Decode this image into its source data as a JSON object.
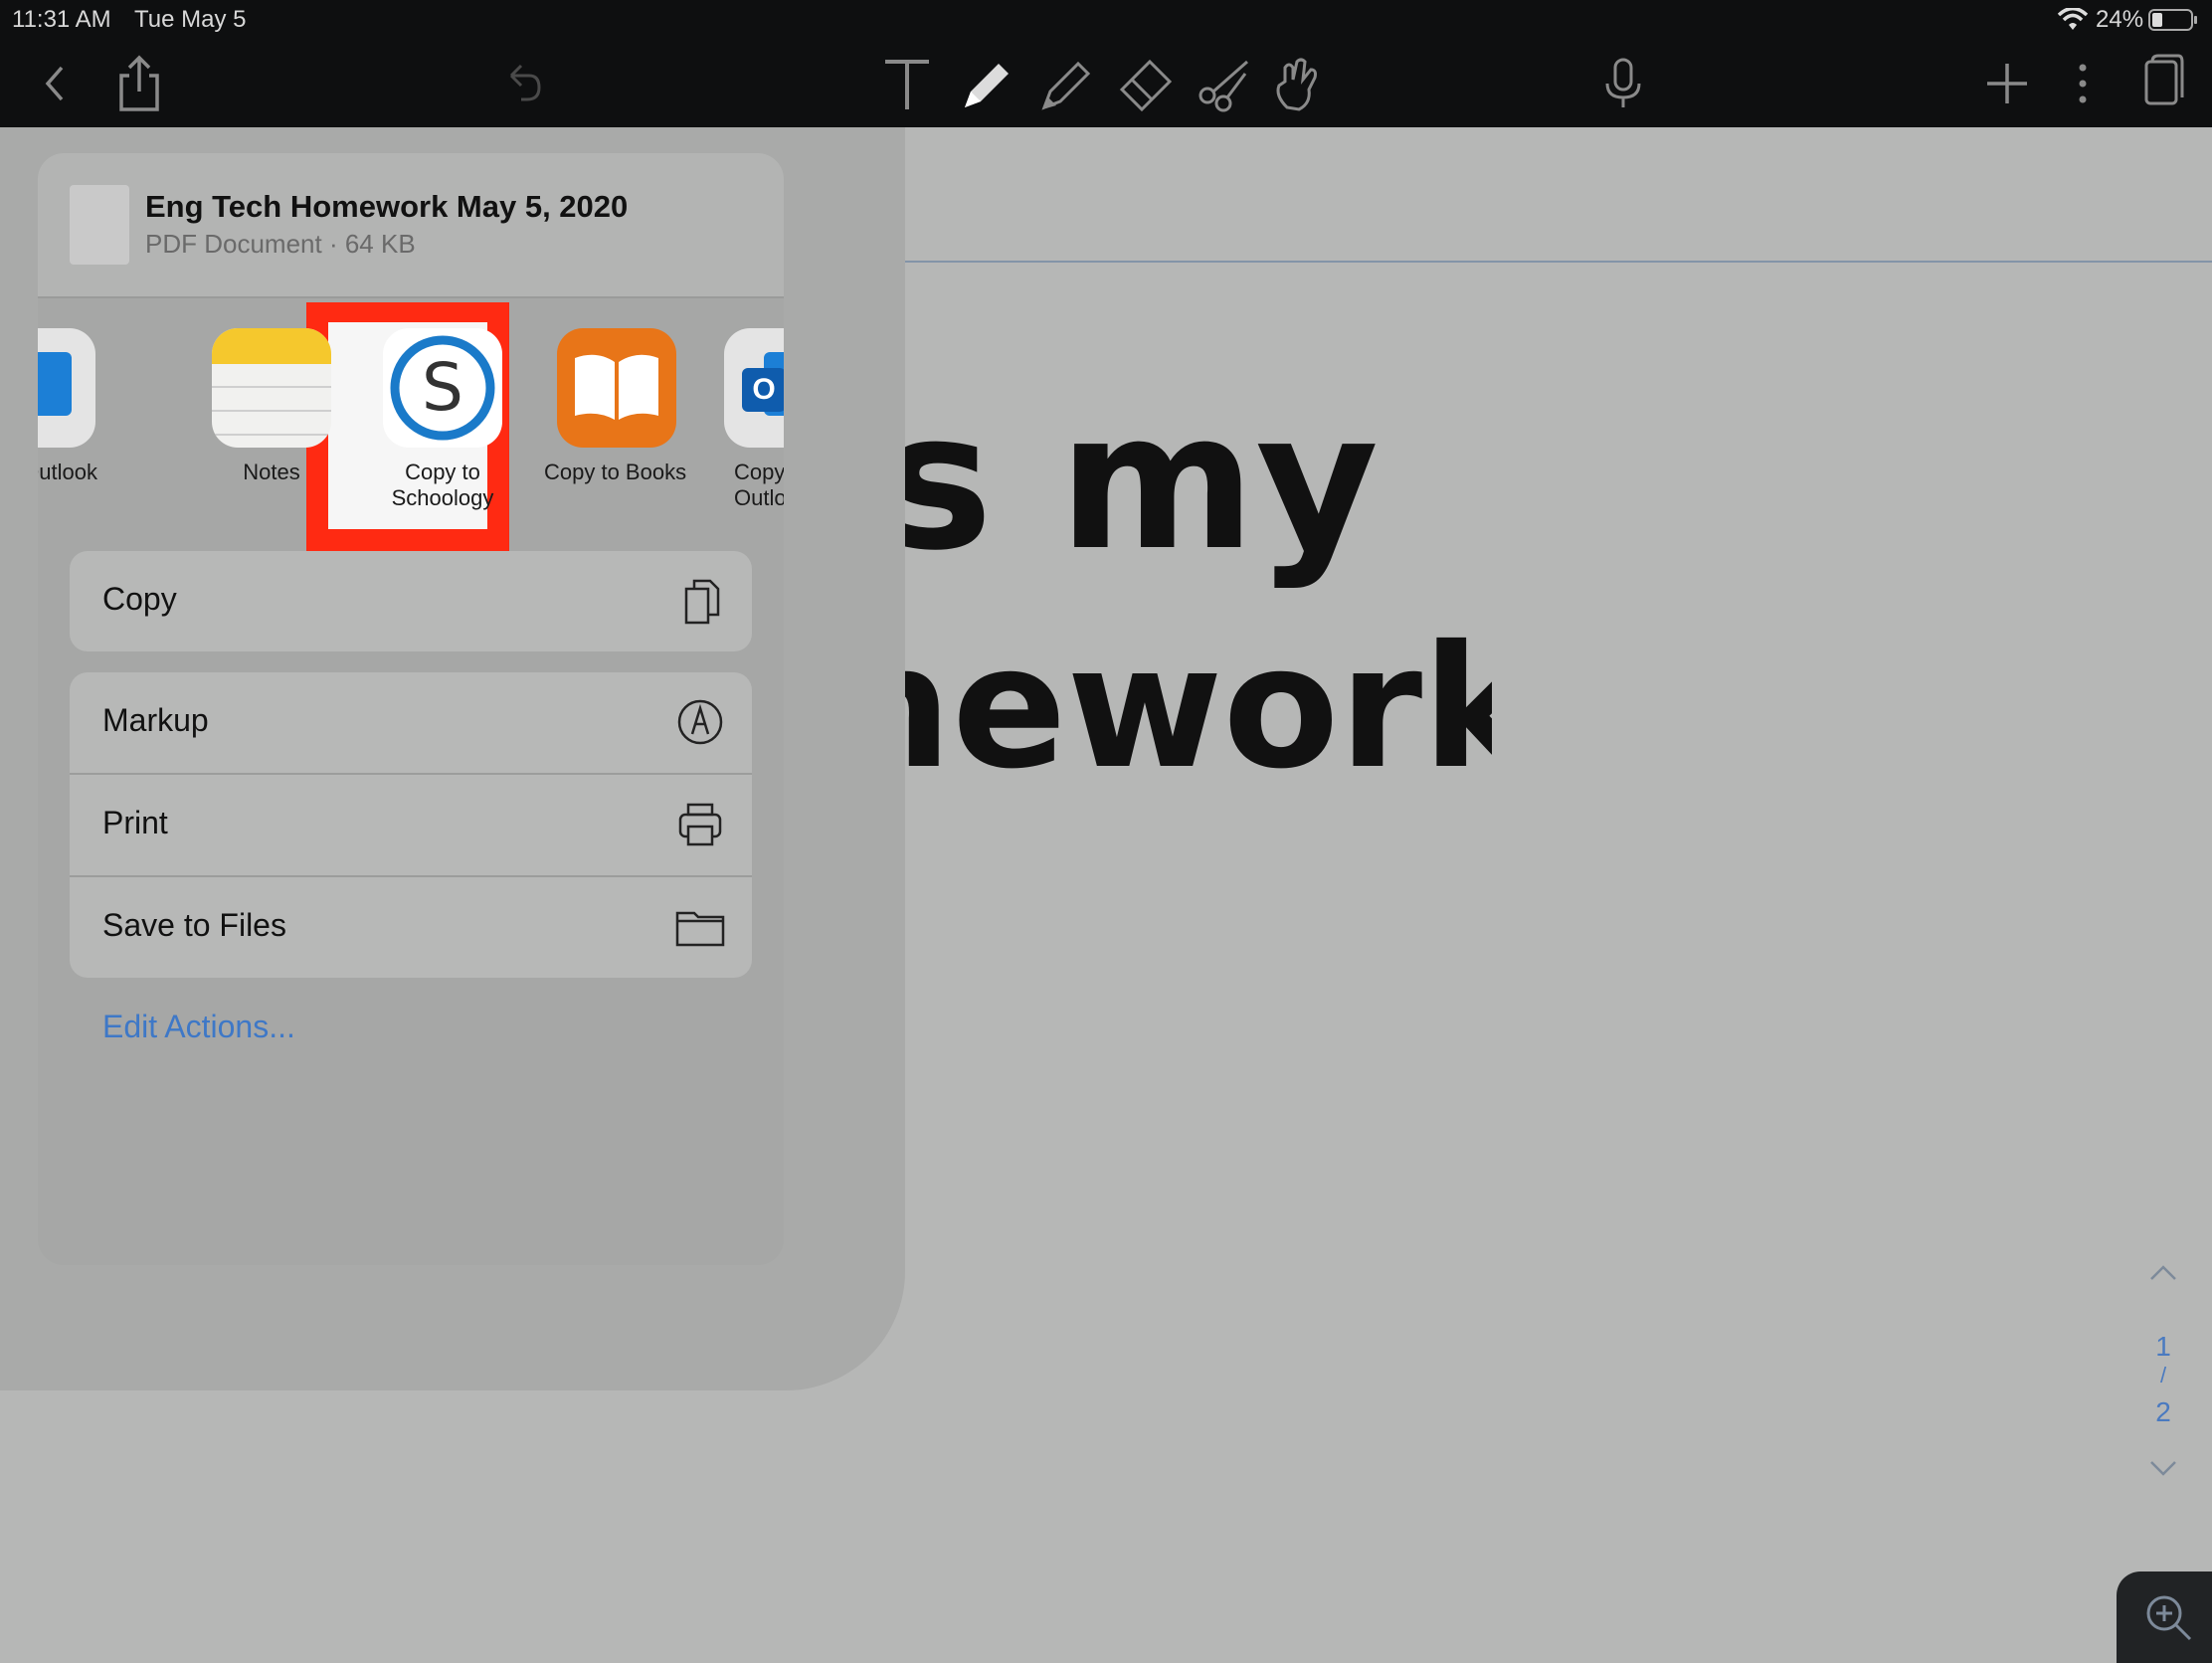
{
  "status_bar": {
    "time": "11:31 AM",
    "date": "Tue May 5",
    "battery_pct": "24%"
  },
  "toolbar": {
    "icons": [
      "back-icon",
      "share-icon",
      "undo-icon",
      "text-icon",
      "pen-icon",
      "highlighter-icon",
      "eraser-icon",
      "scissors-icon",
      "hand-icon",
      "microphone-icon",
      "add-icon",
      "more-icon",
      "pages-icon"
    ]
  },
  "share": {
    "doc_title": "Eng Tech Homework May 5, 2020",
    "doc_subtitle": "PDF Document · 64 KB",
    "apps": [
      {
        "label": "Outlook",
        "icon": "outlook-icon"
      },
      {
        "label": "Notes",
        "icon": "notes-icon"
      },
      {
        "label": "Copy to Schoology",
        "icon": "schoology-icon"
      },
      {
        "label": "Copy to Books",
        "icon": "books-icon"
      },
      {
        "label": "Copy to Outlook",
        "icon": "outlook-icon"
      }
    ],
    "actions_group1": [
      {
        "label": "Copy",
        "icon": "copy-icon"
      }
    ],
    "actions_group2": [
      {
        "label": "Markup",
        "icon": "markup-icon"
      },
      {
        "label": "Print",
        "icon": "printer-icon"
      },
      {
        "label": "Save to Files",
        "icon": "folder-icon"
      }
    ],
    "edit_actions": "Edit Actions..."
  },
  "page": {
    "handwriting_line1": "is my",
    "handwriting_line2": "mework !"
  },
  "pager": {
    "current": "1",
    "separator": "/",
    "total": "2"
  },
  "colors": {
    "highlight": "#ff2a12",
    "link": "#3e78c7",
    "toolbar": "#0e0f10"
  }
}
